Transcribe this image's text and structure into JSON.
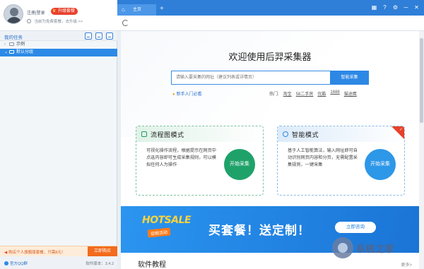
{
  "user": {
    "login_links": "注册|登录",
    "upgrade_label": "升级套餐",
    "version_note": "当前为免费套餐，去升级 >>"
  },
  "sidebar": {
    "task_title": "我的任务",
    "items": [
      {
        "label": "示例",
        "expanded": false,
        "selected": false
      },
      {
        "label": "默认分组",
        "expanded": true,
        "selected": true
      }
    ],
    "promo_text": "购买个人旗舰版套餐，只需8元！",
    "buy_label": "立即购买",
    "qq_group": "官方QQ群",
    "version": "软件版本：3.4.2"
  },
  "tabs": {
    "home_label": "主页",
    "new_tab": "+"
  },
  "window_controls": [
    "▦",
    "?",
    "⚙",
    "─",
    "✕"
  ],
  "main": {
    "welcome": "欢迎使用后羿采集器",
    "search_placeholder": "请输入要采集的网址（建议列表或详情页）",
    "search_button": "智能采集",
    "novice_link": "新手入门必看",
    "hot_label": "热门:",
    "hot_links": [
      "淘宝",
      "58二手房",
      "优酷",
      "1688",
      "猫途鹰"
    ],
    "cards": {
      "flowchart": {
        "title": "流程图模式",
        "desc": "可视化操作流程，根据提示在网页中点选内容即可生成采集规则，可以模拟任何人为操作",
        "button": "开始采集"
      },
      "smart": {
        "title": "智能模式",
        "desc": "基于人工智能算法，输入网址即可自动识别网页内容和分页，无需配置采集规则，一键采集",
        "button": "开始采集"
      }
    },
    "banner": {
      "hotsale": "HOTSALE",
      "hotsale_sub": "促销活动",
      "slogan": "买套餐！送定制！",
      "button": "立即咨询"
    },
    "section_title": "软件教程",
    "more": "更多>"
  },
  "watermark": "系统之家",
  "colors": {
    "accent": "#2f7fd8",
    "green": "#1fa26a",
    "red": "#e8412c",
    "orange": "#f36b1c"
  }
}
